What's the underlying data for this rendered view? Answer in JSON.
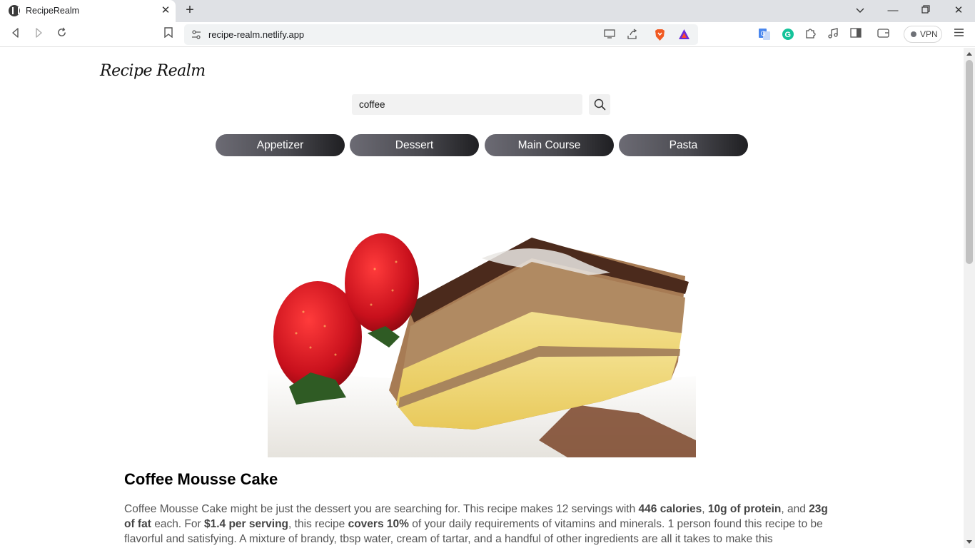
{
  "browser": {
    "tab_title": "RecipeRealm",
    "url": "recipe-realm.netlify.app",
    "vpn_label": "VPN"
  },
  "site": {
    "logo": "Recipe Realm"
  },
  "search": {
    "value": "coffee"
  },
  "categories": [
    "Appetizer",
    "Dessert",
    "Main Course",
    "Pasta"
  ],
  "recipe": {
    "title": "Coffee Mousse Cake",
    "summary_parts": {
      "p1": "Coffee Mousse Cake might be just the dessert you are searching for. This recipe makes 12 servings with ",
      "calories": "446 calories",
      "p2": ", ",
      "protein": "10g of protein",
      "p3": ", and ",
      "fat": "23g of fat",
      "p4": " each. For ",
      "cost": "$1.4 per serving",
      "p5": ", this recipe ",
      "covers": "covers 10%",
      "p6": " of your daily requirements of vitamins and minerals. 1 person found this recipe to be flavorful and satisfying. A mixture of brandy, tbsp water, cream of tartar, and a handful of other ingredients are all it takes to make this"
    }
  }
}
